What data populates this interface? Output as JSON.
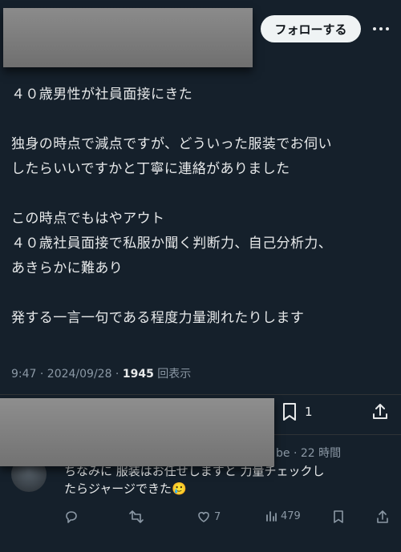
{
  "header": {
    "follow_label": "フォローする"
  },
  "post": {
    "lines": [
      "４０歳男性が社員面接にきた",
      "",
      "独身の時点で減点ですが、どういった服装でお伺い",
      "したらいいですかと丁寧に連絡がありました",
      "",
      "この時点でもはやアウト",
      "４０歳社員面接で私服か聞く判断力、自己分析力、",
      "あきらかに難あり",
      "",
      "発する一言一句である程度力量測れたりします"
    ],
    "time": "9:47 · 2024/09/28 · ",
    "views_count": "1945",
    "views_label": " 回表示",
    "bookmark_count": "1"
  },
  "reply": {
    "handle_fragment": "be · 22 時間",
    "lines": [
      "ちなみに 服装はお任せしますと 力量チェックし",
      "たらジャージできた🥲"
    ],
    "like_count": "7",
    "view_count": "479"
  },
  "icons": [
    "more-icon",
    "bookmark-icon",
    "share-icon",
    "reply-icon",
    "retweet-icon",
    "like-icon",
    "views-icon"
  ]
}
